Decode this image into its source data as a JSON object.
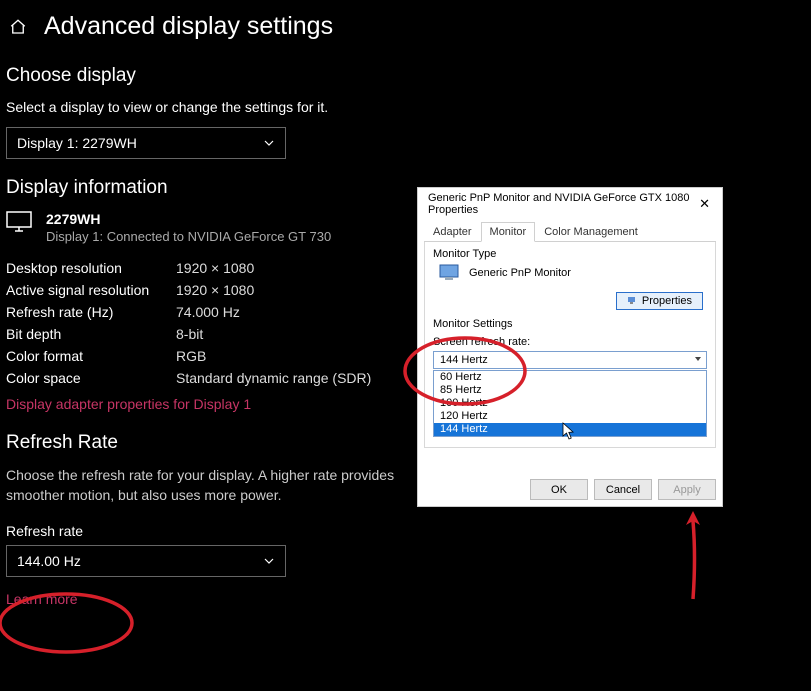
{
  "header": {
    "title": "Advanced display settings"
  },
  "choose": {
    "heading": "Choose display",
    "desc": "Select a display to view or change the settings for it.",
    "dropdown": "Display 1: 2279WH"
  },
  "info": {
    "heading": "Display information",
    "display_name": "2279WH",
    "display_sub": "Display 1: Connected to NVIDIA GeForce GT 730",
    "rows": {
      "desktop_res_k": "Desktop resolution",
      "desktop_res_v": "1920 × 1080",
      "active_res_k": "Active signal resolution",
      "active_res_v": "1920 × 1080",
      "refresh_k": "Refresh rate (Hz)",
      "refresh_v": "74.000 Hz",
      "bit_k": "Bit depth",
      "bit_v": "8-bit",
      "cf_k": "Color format",
      "cf_v": "RGB",
      "cs_k": "Color space",
      "cs_v": "Standard dynamic range (SDR)"
    },
    "link": "Display adapter properties for Display 1"
  },
  "refresh": {
    "heading": "Refresh Rate",
    "desc": "Choose the refresh rate for your display. A higher rate provides smoother motion, but also uses more power.",
    "label": "Refresh rate",
    "dropdown": "144.00 Hz",
    "learn": "Learn more"
  },
  "dialog": {
    "title": "Generic PnP Monitor and NVIDIA GeForce GTX 1080 Properties",
    "tabs": {
      "adapter": "Adapter",
      "monitor": "Monitor",
      "color": "Color Management"
    },
    "monitor_type_label": "Monitor Type",
    "monitor_type_value": "Generic PnP Monitor",
    "properties_btn": "Properties",
    "monitor_settings_label": "Monitor Settings",
    "screen_refresh_label": "Screen refresh rate:",
    "combo_selected": "144 Hertz",
    "options": {
      "o0": "60 Hertz",
      "o1": "85 Hertz",
      "o2": "100 Hertz",
      "o3": "120 Hertz",
      "o4": "144 Hertz"
    },
    "ok": "OK",
    "cancel": "Cancel",
    "apply": "Apply"
  }
}
